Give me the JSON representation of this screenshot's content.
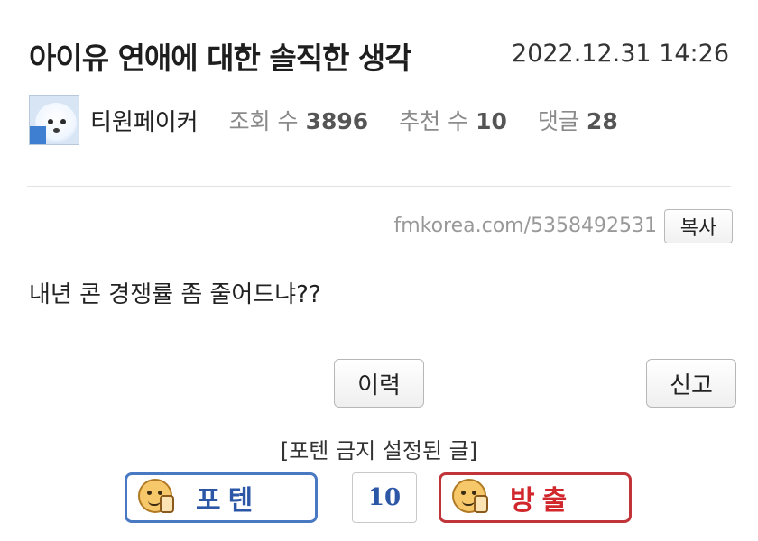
{
  "post": {
    "title": "아이유 연애에 대한 솔직한 생각",
    "datetime": "2022.12.31 14:26",
    "author": "티원페이커",
    "views_label": "조회 수",
    "views": "3896",
    "recommend_label": "추천 수",
    "recommend": "10",
    "comments_label": "댓글",
    "comments": "28",
    "avatar_icon": "polar-bear-avatar-icon",
    "url": "fmkorea.com/5358492531",
    "copy_label": "복사",
    "body": "내년 콘 경쟁률 좀 줄어드냐??"
  },
  "actions": {
    "history_label": "이력",
    "report_label": "신고"
  },
  "voting": {
    "notice": "[포텐 금지 설정된 글]",
    "up_label": "포텐",
    "down_label": "방출",
    "count": "10",
    "up_icon": "thumbs-up-emoji-icon",
    "down_icon": "thumbs-down-emoji-icon",
    "up_color": "#4a79c4",
    "down_color": "#c0343a"
  }
}
